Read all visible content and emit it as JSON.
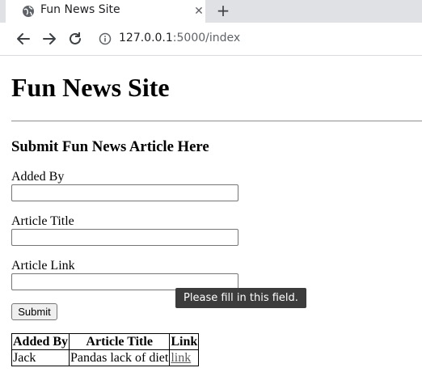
{
  "browser": {
    "tab_title": "Fun News Site",
    "tab_close": "✕",
    "new_tab": "+",
    "url_host": "127.0.0.1",
    "url_rest": ":5000/index"
  },
  "page": {
    "title": "Fun News Site",
    "form_heading": "Submit Fun News Article Here",
    "fields": [
      {
        "label": "Added By",
        "value": ""
      },
      {
        "label": "Article Title",
        "value": ""
      },
      {
        "label": "Article Link",
        "value": ""
      }
    ],
    "submit_label": "Submit",
    "validation_tooltip": "Please fill in this field."
  },
  "table": {
    "headers": [
      "Added By",
      "Article Title",
      "Link"
    ],
    "rows": [
      {
        "added_by": "Jack",
        "title": "Pandas lack of diet",
        "link": "link"
      }
    ]
  },
  "colors": {
    "tabstrip": "#dfe1e5",
    "tooltip_bg": "#3c3c3c",
    "link": "#5a5a5a"
  },
  "icons": {
    "tab": "globe-icon",
    "back": "back-arrow-icon",
    "forward": "forward-arrow-icon",
    "reload": "reload-icon",
    "site_info": "info-icon"
  }
}
